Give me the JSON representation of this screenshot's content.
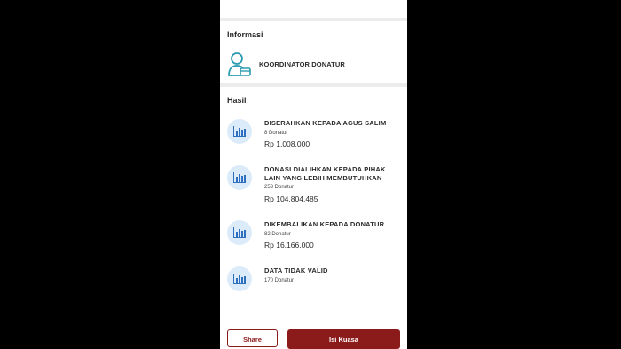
{
  "informasi": {
    "title": "Informasi",
    "role_label": "KOORDINATOR DONATUR",
    "role_icon": "person-card-icon"
  },
  "hasil": {
    "title": "Hasil",
    "items": [
      {
        "title": "DISERAHKAN KEPADA AGUS SALIM",
        "count": "8 Donatur",
        "amount": "Rp 1.008.000",
        "icon": "bar-chart-icon"
      },
      {
        "title": "DONASI DIALIHKAN KEPADA PIHAK LAIN YANG LEBIH MEMBUTUHKAN",
        "count": "253 Donatur",
        "amount": "Rp 104.804.485",
        "icon": "bar-chart-icon"
      },
      {
        "title": "DIKEMBALIKAN KEPADA DONATUR",
        "count": "82 Donatur",
        "amount": "Rp 16.166.000",
        "icon": "bar-chart-icon"
      },
      {
        "title": "DATA TIDAK VALID",
        "count": "170 Donatur",
        "icon": "bar-chart-icon"
      }
    ]
  },
  "actions": {
    "share_label": "Share",
    "kuasa_label": "Isi Kuasa"
  },
  "colors": {
    "accent": "#8b1a1a",
    "icon_teal": "#2a9bb0",
    "icon_bg": "#dcebf9",
    "icon_blue": "#2f6fc0"
  }
}
